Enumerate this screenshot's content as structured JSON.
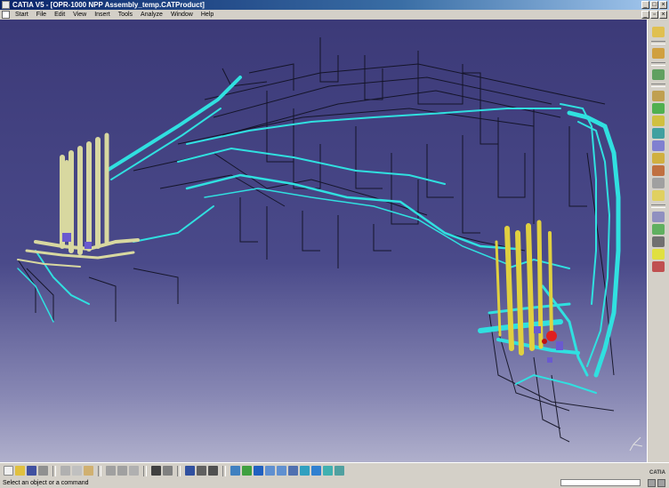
{
  "window": {
    "title": "CATIA V5 - [OPR-1000 NPP Assembly_temp.CATProduct]"
  },
  "menu": {
    "items": [
      "Start",
      "File",
      "Edit",
      "View",
      "Insert",
      "Tools",
      "Analyze",
      "Window",
      "Help"
    ]
  },
  "status": {
    "prompt": "Select an object or a command"
  },
  "logo": {
    "text": "CATIA"
  },
  "viewport": {
    "content": "3D piping assembly model",
    "background_top": "#3c3a78",
    "background_bottom": "#b0b0cc",
    "pipe_color_cyan": "#30e0e0",
    "pipe_color_yellow": "#e0d040",
    "pipe_color_cream": "#d8d8a0",
    "structure_color": "#101020",
    "valve_color": "#e02020"
  },
  "icons": {
    "right_toolbar": [
      "sketch-icon",
      "product-icon",
      "insert-component-icon",
      "move-icon",
      "constraint-icon",
      "snap-icon",
      "explode-icon",
      "clash-icon",
      "section-icon",
      "distance-icon",
      "annotation-icon",
      "catalog-icon",
      "bill-of-material-icon",
      "scene-icon",
      "render-icon",
      "light-icon",
      "tools-icon"
    ],
    "bottom_toolbar": [
      "new-icon",
      "open-icon",
      "save-icon",
      "print-icon",
      "cut-icon",
      "copy-icon",
      "paste-icon",
      "undo-icon",
      "redo-icon",
      "whats-this-icon",
      "formula-icon",
      "comment-icon",
      "catalog-browser-icon",
      "knowledge-icon",
      "fly-mode-icon",
      "fit-all-icon",
      "pan-icon",
      "rotate-icon",
      "zoom-in-icon",
      "zoom-out-icon",
      "normal-view-icon",
      "iso-view-icon",
      "shading-icon",
      "hide-show-icon",
      "swap-visible-icon"
    ]
  }
}
